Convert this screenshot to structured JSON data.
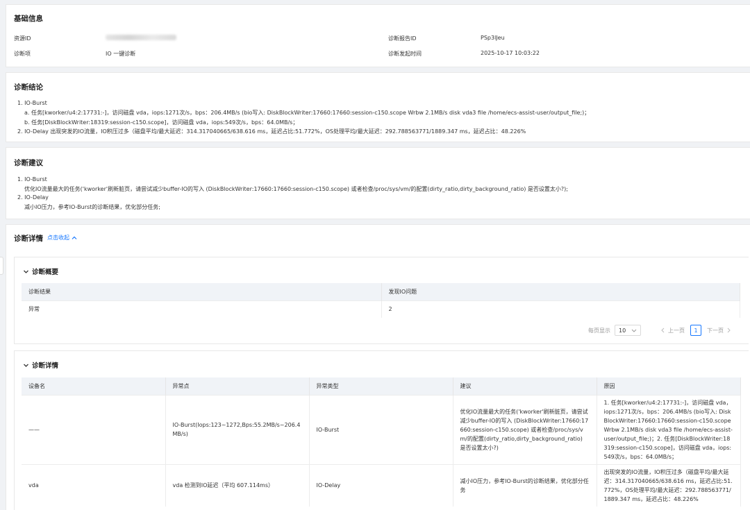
{
  "basic": {
    "title": "基础信息",
    "resource_id_label": "资源ID",
    "report_id_label": "诊断报告ID",
    "report_id": "PSp3lJeu",
    "item_label": "诊断项",
    "item": "IO 一键诊断",
    "time_label": "诊断发起时间",
    "time": "2025-10-17 10:03:22"
  },
  "conclusion": {
    "title": "诊断结论",
    "lines": [
      "1. IO-Burst",
      "a. 任务[kworker/u4:2:17731:-]，访问磁盘 vda，iops:1271次/s，bps：206.4MB/s (bio写入: DiskBlockWriter:17660:17660:session-c150.scope Wrbw 2.1MB/s disk vda3 file /home/ecs-assist-user/output_file;)；",
      "b. 任务[DiskBlockWriter:18319:session-c150.scope]，访问磁盘 vda，iops:549次/s，bps：64.0MB/s；",
      "2. IO-Delay 出现突发的IO流量，IO积压过多（磁盘平均/最大延迟：314.317040665/638.616 ms，延迟占比:51.772%，OS处理平均/最大延迟：292.788563771/1889.347 ms，延迟占比：48.226%"
    ]
  },
  "advice": {
    "title": "诊断建议",
    "lines": [
      "1. IO-Burst",
      "优化IO流量最大的任务('kworker'刷新脏页，请尝试减少buffer-IO的写入 (DiskBlockWriter:17660:17660:session-c150.scope) 或者检查/proc/sys/vm/的配置(dirty_ratio,dirty_background_ratio) 是否设置太小?);",
      "2. IO-Delay",
      "减小IO压力，参考IO-Burst的诊断结果，优化部分任务;"
    ]
  },
  "details": {
    "title": "诊断详情",
    "toggle": "点击收起",
    "summary": {
      "title": "诊断概要",
      "headers": [
        "诊断结果",
        "发现IO问题"
      ],
      "rows": [
        [
          "异常",
          "2"
        ]
      ],
      "pager": {
        "per_page_label": "每页显示",
        "per_page": "10",
        "prev": "上一页",
        "page": "1",
        "next": "下一页"
      }
    },
    "detail": {
      "title": "诊断详情",
      "headers": [
        "设备名",
        "异常点",
        "异常类型",
        "建议",
        "原因"
      ],
      "rows": [
        [
          "——",
          "IO-Burst(Iops:123~1272,Bps:55.2MB/s~206.4MB/s)",
          "IO-Burst",
          "优化IO流量最大的任务('kworker'刷新脏页，请尝试减少buffer-IO的写入 (DiskBlockWriter:17660:17660:session-c150.scope) 或者检查/proc/sys/vm/的配置(dirty_ratio,dirty_background_ratio) 是否设置太小?)",
          "1. 任务[kworker/u4:2:17731:-]，访问磁盘 vda，iops:1271次/s，bps：206.4MB/s (bio写入: DiskBlockWriter:17660:17660:session-c150.scope Wrbw 2.1MB/s disk vda3 file /home/ecs-assist-user/output_file;)；2. 任务[DiskBlockWriter:18319:session-c150.scope]，访问磁盘 vda，iops:549次/s，bps：64.0MB/s；"
        ],
        [
          "vda",
          "vda 检测到IO延迟（平均 607.114ms）",
          "IO-Delay",
          "减小IO压力，参考IO-Burst的诊断结果，优化部分任务",
          "出现突发的IO流量，IO积压过多（磁盘平均/最大延迟：314.317040665/638.616 ms，延迟占比:51.772%，OS处理平均/最大延迟：292.788563771/1889.347 ms，延迟占比：48.226%"
        ]
      ]
    }
  }
}
